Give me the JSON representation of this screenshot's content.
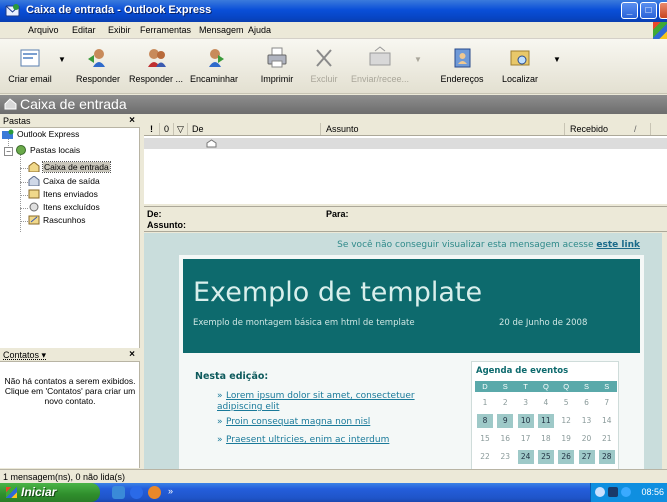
{
  "window": {
    "title": "Caixa de entrada - Outlook Express",
    "icon": "outlook-express-icon",
    "controls": [
      "minimize",
      "maximize",
      "close"
    ]
  },
  "menu": [
    "Arquivo",
    "Editar",
    "Exibir",
    "Ferramentas",
    "Mensagem",
    "Ajuda"
  ],
  "toolbar": {
    "create": "Criar email",
    "reply": "Responder",
    "reply_all": "Responder ...",
    "forward": "Encaminhar",
    "print": "Imprimir",
    "delete": "Excluir",
    "send_receive": "Enviar/recee...",
    "addresses": "Endereços",
    "find": "Localizar"
  },
  "folder_header": "Caixa de entrada",
  "folders_pane": {
    "title": "Pastas",
    "close": "×",
    "root": "Outlook Express",
    "local": "Pastas locais",
    "items": [
      "Caixa de entrada",
      "Caixa de saída",
      "Itens enviados",
      "Itens excluídos",
      "Rascunhos"
    ],
    "selected": "Caixa de entrada"
  },
  "contacts_pane": {
    "title": "Contatos ▾",
    "close": "×",
    "message": "Não há contatos a serem exibidos. Clique em 'Contatos' para criar um novo contato."
  },
  "message_list": {
    "columns": {
      "priority": "!",
      "attachment": "0",
      "flag": "▽",
      "from": "De",
      "subject": "Assunto",
      "received": "Recebido",
      "sort_arrow": "/"
    }
  },
  "preview_header": {
    "from_label": "De:",
    "to_label": "Para:",
    "subject_label": "Assunto:"
  },
  "preview": {
    "notice": "Se você não conseguir visualizar esta mensagem acesse",
    "notice_link": "este link",
    "template_title": "Exemplo de template",
    "template_subtitle": "Exemplo de montagem básica em html de template",
    "template_date": "20 de Junho de 2008",
    "edition_heading": "Nesta edição:",
    "items": [
      "Lorem ipsum dolor sit amet, consectetuer adipiscing elit",
      "Proin consequat magna non nisl",
      "Praesent ultricies, enim ac interdum"
    ],
    "agenda_title": "Agenda de eventos",
    "calendar_days": [
      "D",
      "S",
      "T",
      "Q",
      "Q",
      "S",
      "S"
    ],
    "calendar_rows": [
      [
        "1",
        "2",
        "3",
        "4",
        "5",
        "6",
        "7"
      ],
      [
        "8",
        "9",
        "10",
        "11",
        "12",
        "13",
        "14"
      ],
      [
        "15",
        "16",
        "17",
        "18",
        "19",
        "20",
        "21"
      ],
      [
        "22",
        "23",
        "24",
        "25",
        "26",
        "27",
        "28"
      ]
    ],
    "event_days": [
      "8",
      "9",
      "10",
      "11",
      "24",
      "25",
      "26",
      "27",
      "28"
    ]
  },
  "status": "1 mensagem(ns), 0 não lida(s)",
  "taskbar": {
    "start": "Iniciar",
    "clock": "08:56",
    "overflow": "»"
  },
  "colors": {
    "template_header": "#0d6a6d",
    "preview_bg": "#c9dddc",
    "link": "#1a7a9a",
    "title_bar": "#0a4fd8"
  }
}
